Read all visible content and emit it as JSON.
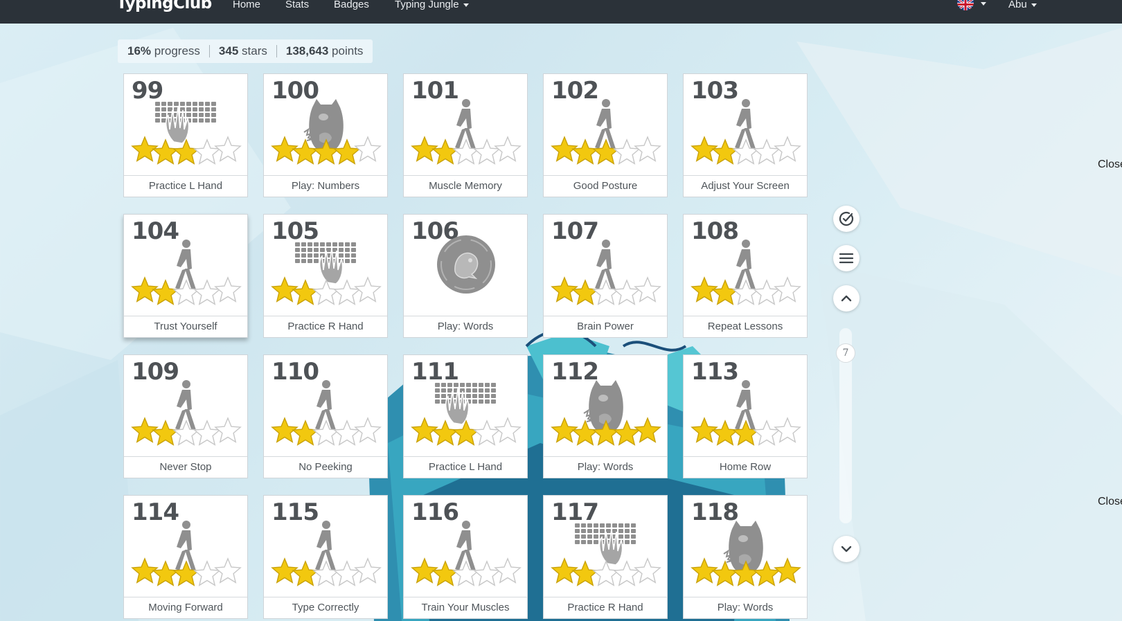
{
  "header": {
    "logo": "TypingClub",
    "nav": [
      {
        "label": "Home"
      },
      {
        "label": "Stats"
      },
      {
        "label": "Badges"
      },
      {
        "label": "Typing Jungle"
      }
    ],
    "language_icon": "uk-flag-icon",
    "user": "Abu"
  },
  "stats": {
    "progress_value": "16%",
    "progress_label": "progress",
    "stars_value": "345",
    "stars_label": "stars",
    "points_value": "138,643",
    "points_label": "points"
  },
  "lessons": [
    {
      "number": "99",
      "title": "Practice L Hand",
      "icon": "keyboard-left-hand-icon",
      "stars": 3
    },
    {
      "number": "100",
      "title": "Play: Numbers",
      "icon": "monster-icon",
      "stars": 4
    },
    {
      "number": "101",
      "title": "Muscle Memory",
      "icon": "walker-icon",
      "stars": 2
    },
    {
      "number": "102",
      "title": "Good Posture",
      "icon": "walker-icon",
      "stars": 3
    },
    {
      "number": "103",
      "title": "Adjust Your Screen",
      "icon": "walker-icon",
      "stars": 2
    },
    {
      "number": "104",
      "title": "Trust Yourself",
      "icon": "walker-icon",
      "stars": 2
    },
    {
      "number": "105",
      "title": "Practice R Hand",
      "icon": "keyboard-right-hand-icon",
      "stars": 2
    },
    {
      "number": "106",
      "title": "Play: Words",
      "icon": "game-badge-icon",
      "stars": 0
    },
    {
      "number": "107",
      "title": "Brain Power",
      "icon": "walker-icon",
      "stars": 2
    },
    {
      "number": "108",
      "title": "Repeat Lessons",
      "icon": "walker-icon",
      "stars": 2
    },
    {
      "number": "109",
      "title": "Never Stop",
      "icon": "walker-icon",
      "stars": 2
    },
    {
      "number": "110",
      "title": "No Peeking",
      "icon": "walker-icon",
      "stars": 2
    },
    {
      "number": "111",
      "title": "Practice L Hand",
      "icon": "keyboard-left-hand-icon",
      "stars": 3
    },
    {
      "number": "112",
      "title": "Play: Words",
      "icon": "monster-icon",
      "stars": 5
    },
    {
      "number": "113",
      "title": "Home Row",
      "icon": "walker-icon",
      "stars": 3
    },
    {
      "number": "114",
      "title": "Moving Forward",
      "icon": "walker-icon",
      "stars": 3
    },
    {
      "number": "115",
      "title": "Type Correctly",
      "icon": "walker-icon",
      "stars": 2
    },
    {
      "number": "116",
      "title": "Train Your Muscles",
      "icon": "walker-icon",
      "stars": 2
    },
    {
      "number": "117",
      "title": "Practice R Hand",
      "icon": "keyboard-right-hand-icon",
      "stars": 2
    },
    {
      "number": "118",
      "title": "Play: Words",
      "icon": "monster-icon",
      "stars": 5
    }
  ],
  "side_controls": {
    "check_icon": "check-circle-icon",
    "menu_icon": "menu-icon",
    "up_icon": "chevron-up-icon",
    "down_icon": "chevron-down-icon",
    "page_indicator": "7"
  },
  "edge_text": [
    "Close",
    "Close"
  ],
  "colors": {
    "topbar": "#2b3239",
    "star_filled": "#f2c80f",
    "icon_gray": "#8f8f8f"
  }
}
